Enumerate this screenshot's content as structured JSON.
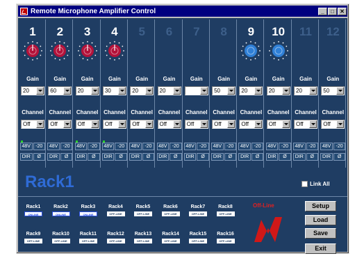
{
  "window": {
    "title": "Remote Microphone Amplifier Control",
    "minimize_label": "_",
    "maximize_label": "□",
    "close_label": "✕"
  },
  "channels": [
    {
      "number": "1",
      "active": true,
      "knob": "red",
      "gain": "20",
      "channel": "Off",
      "phantom": "48V",
      "pad": "-20",
      "dir": "DIR",
      "phase": "Ø",
      "led": true
    },
    {
      "number": "2",
      "active": true,
      "knob": "red",
      "gain": "60",
      "channel": "Off",
      "phantom": "48V",
      "pad": "-20",
      "dir": "DIR",
      "phase": "Ø",
      "led": false
    },
    {
      "number": "3",
      "active": true,
      "knob": "red",
      "gain": "20",
      "channel": "Off",
      "phantom": "48V",
      "pad": "-20",
      "dir": "DIR",
      "phase": "Ø",
      "led": true
    },
    {
      "number": "4",
      "active": true,
      "knob": "red",
      "gain": "30",
      "channel": "Off",
      "phantom": "48V",
      "pad": "-20",
      "dir": "DIR",
      "phase": "Ø",
      "led": true
    },
    {
      "number": "5",
      "active": false,
      "knob": "none",
      "gain": "20",
      "channel": "Off",
      "phantom": "48V",
      "pad": "-20",
      "dir": "DIR",
      "phase": "Ø",
      "led": false
    },
    {
      "number": "6",
      "active": false,
      "knob": "none",
      "gain": "20",
      "channel": "Off",
      "phantom": "48V",
      "pad": "-20",
      "dir": "DIR",
      "phase": "Ø",
      "led": false
    },
    {
      "number": "7",
      "active": false,
      "knob": "none",
      "gain": "",
      "channel": "Off",
      "phantom": "48V",
      "pad": "-20",
      "dir": "DIR",
      "phase": "Ø",
      "led": false
    },
    {
      "number": "8",
      "active": false,
      "knob": "none",
      "gain": "50",
      "channel": "Off",
      "phantom": "48V",
      "pad": "-20",
      "dir": "DIR",
      "phase": "Ø",
      "led": false
    },
    {
      "number": "9",
      "active": true,
      "knob": "blue",
      "gain": "20",
      "channel": "Off",
      "phantom": "48V",
      "pad": "-20",
      "dir": "DIR",
      "phase": "Ø",
      "led": false
    },
    {
      "number": "10",
      "active": true,
      "knob": "blue",
      "gain": "20",
      "channel": "Off",
      "phantom": "48V",
      "pad": "-20",
      "dir": "DIR",
      "phase": "Ø",
      "led": false
    },
    {
      "number": "11",
      "active": false,
      "knob": "none",
      "gain": "20",
      "channel": "Off",
      "phantom": "48V",
      "pad": "-20",
      "dir": "DIR",
      "phase": "Ø",
      "led": false
    },
    {
      "number": "12",
      "active": false,
      "knob": "none",
      "gain": "50",
      "channel": "Off",
      "phantom": "48V",
      "pad": "-20",
      "dir": "DIR",
      "phase": "Ø",
      "led": false
    }
  ],
  "labels": {
    "gain": "Gain",
    "channel": "Channel",
    "rack_title": "Rack1",
    "link_all": "Link All",
    "offline": "Off-Line"
  },
  "racks": [
    {
      "name": "Rack1",
      "status": "online",
      "status_text": "ONLINE"
    },
    {
      "name": "Rack2",
      "status": "online",
      "status_text": "ONLINE"
    },
    {
      "name": "Rack3",
      "status": "online",
      "status_text": "ONLINE"
    },
    {
      "name": "Rack4",
      "status": "offline",
      "status_text": "OFF-LINE"
    },
    {
      "name": "Rack5",
      "status": "offline",
      "status_text": "OFF-LINE"
    },
    {
      "name": "Rack6",
      "status": "offline",
      "status_text": "OFF-LINE"
    },
    {
      "name": "Rack7",
      "status": "offline",
      "status_text": "OFF-LINE"
    },
    {
      "name": "Rack8",
      "status": "offline",
      "status_text": "OFF-LINE"
    },
    {
      "name": "Rack9",
      "status": "offline",
      "status_text": "OFF-LINE"
    },
    {
      "name": "Rack10",
      "status": "offline",
      "status_text": "OFF-LINE"
    },
    {
      "name": "Rack11",
      "status": "offline",
      "status_text": "OFF-LINE"
    },
    {
      "name": "Rack12",
      "status": "offline",
      "status_text": "OFF-LINE"
    },
    {
      "name": "Rack13",
      "status": "offline",
      "status_text": "OFF-LINE"
    },
    {
      "name": "Rack14",
      "status": "offline",
      "status_text": "OFF-LINE"
    },
    {
      "name": "Rack15",
      "status": "offline",
      "status_text": "OFF-LINE"
    },
    {
      "name": "Rack16",
      "status": "offline",
      "status_text": "OFF-LINE"
    }
  ],
  "buttons": {
    "setup": "Setup",
    "load": "Load",
    "save": "Save",
    "exit": "Exit"
  },
  "colors": {
    "panel": "#1f3d63",
    "titlebar": "#000080",
    "knob_red": "#b3123a",
    "knob_blue": "#2f7fd6",
    "offline_red": "#e02020"
  }
}
